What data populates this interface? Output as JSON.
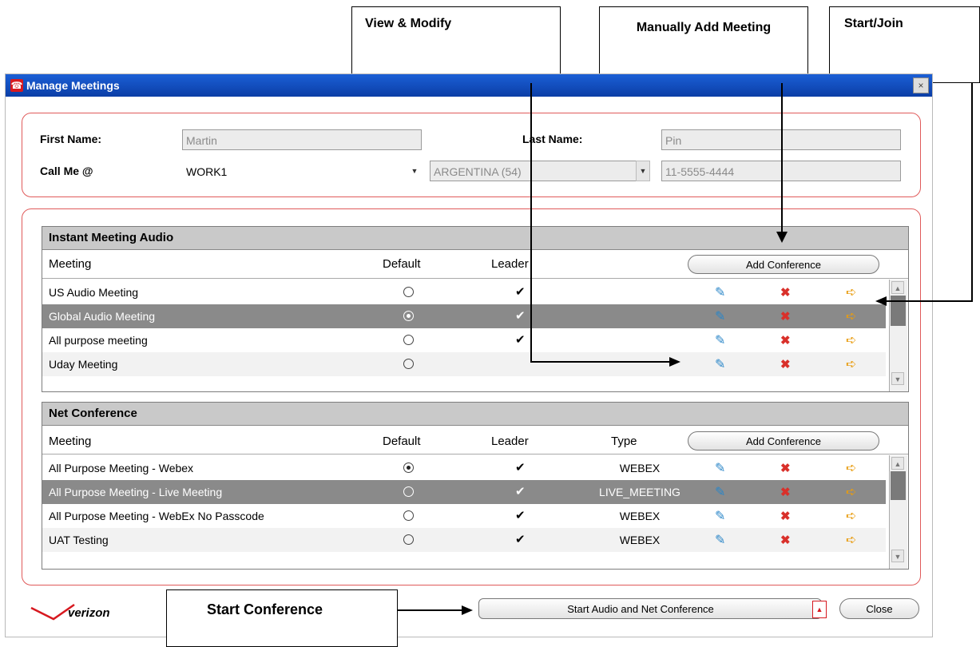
{
  "window": {
    "title": "Manage Meetings",
    "close_icon": "close-icon"
  },
  "contact": {
    "first_name_label": "First Name:",
    "first_name_value": "Martin",
    "last_name_label": "Last Name:",
    "last_name_value": "Pin",
    "call_me_label": "Call Me @",
    "call_me_value": "WORK1",
    "country_value": "ARGENTINA (54)",
    "phone_value": "11-5555-4444"
  },
  "instant_audio": {
    "title": "Instant Meeting Audio",
    "columns": {
      "meeting": "Meeting",
      "default": "Default",
      "leader": "Leader"
    },
    "add_label": "Add Conference",
    "rows": [
      {
        "name": "US Audio Meeting",
        "default": false,
        "leader": true
      },
      {
        "name": "Global Audio Meeting",
        "default": true,
        "leader": true
      },
      {
        "name": "All purpose meeting",
        "default": false,
        "leader": true
      },
      {
        "name": "Uday Meeting",
        "default": false,
        "leader": false
      }
    ]
  },
  "net_conference": {
    "title": "Net Conference",
    "columns": {
      "meeting": "Meeting",
      "default": "Default",
      "leader": "Leader",
      "type": "Type"
    },
    "add_label": "Add Conference",
    "rows": [
      {
        "name": "All Purpose Meeting - Webex",
        "default": true,
        "leader": true,
        "type": "WEBEX"
      },
      {
        "name": "All Purpose Meeting - Live Meeting",
        "default": false,
        "leader": true,
        "type": "LIVE_MEETING"
      },
      {
        "name": "All Purpose Meeting - WebEx No Passcode",
        "default": false,
        "leader": true,
        "type": "WEBEX"
      },
      {
        "name": "UAT Testing",
        "default": false,
        "leader": true,
        "type": "WEBEX"
      }
    ]
  },
  "footer": {
    "logo_text": "verizon",
    "start_label": "Start Audio and Net Conference",
    "close_label": "Close"
  },
  "callouts": {
    "view_modify": "View & Modify",
    "manually_add": "Manually Add Meeting",
    "start_join": "Start/Join",
    "start_conference": "Start Conference"
  },
  "glyphs": {
    "check": "✔",
    "pencil": "✎",
    "delete": "✖",
    "go": "➪"
  }
}
